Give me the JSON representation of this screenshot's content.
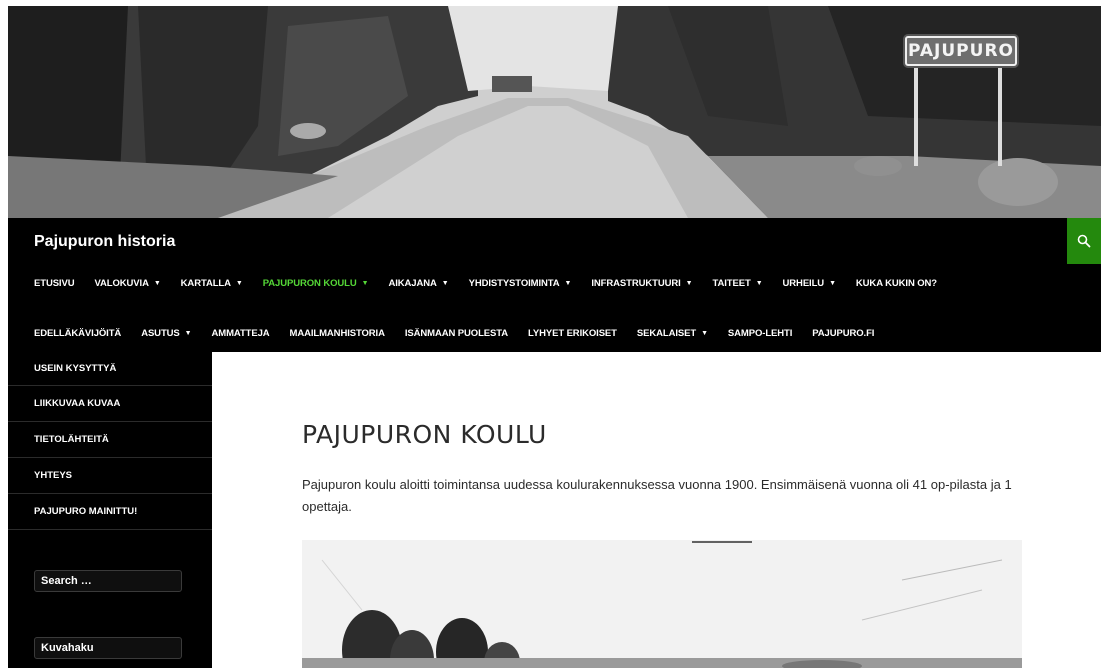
{
  "header": {
    "sign_text": "PAJUPURO"
  },
  "masthead": {
    "site_title": "Pajupuron historia",
    "accent_color": "#24890d",
    "active_color": "#55d737",
    "search_icon": "search-icon"
  },
  "nav": {
    "row1": [
      {
        "label": "ETUSIVU",
        "dropdown": false
      },
      {
        "label": "VALOKUVIA",
        "dropdown": true
      },
      {
        "label": "KARTALLA",
        "dropdown": true
      },
      {
        "label": "PAJUPURON KOULU",
        "dropdown": true,
        "active": true
      },
      {
        "label": "AIKAJANA",
        "dropdown": true
      },
      {
        "label": "YHDISTYSTOIMINTA",
        "dropdown": true
      },
      {
        "label": "INFRASTRUKTUURI",
        "dropdown": true
      },
      {
        "label": "TAITEET",
        "dropdown": true
      },
      {
        "label": "URHEILU",
        "dropdown": true
      },
      {
        "label": "KUKA KUKIN ON?",
        "dropdown": false
      }
    ],
    "row2": [
      {
        "label": "EDELLÄKÄVIJÖITÄ",
        "dropdown": false
      },
      {
        "label": "ASUTUS",
        "dropdown": true
      },
      {
        "label": "AMMATTEJA",
        "dropdown": false
      },
      {
        "label": "MAAILMANHISTORIA",
        "dropdown": false
      },
      {
        "label": "ISÄNMAAN PUOLESTA",
        "dropdown": false
      },
      {
        "label": "LYHYET ERIKOISET",
        "dropdown": false
      },
      {
        "label": "SEKALAISET",
        "dropdown": true
      },
      {
        "label": "SAMPO-LEHTI",
        "dropdown": false
      },
      {
        "label": "PAJUPURO.FI",
        "dropdown": false
      }
    ]
  },
  "sidebar": {
    "links": [
      "USEIN KYSYTTYÄ",
      "LIIKKUVAA KUVAA",
      "TIETOLÄHTEITÄ",
      "YHTEYS",
      "PAJUPURO MAINITTU!"
    ],
    "search_placeholder": "Search …",
    "image_search_value": "Kuvahaku"
  },
  "content": {
    "title": "PAJUPURON KOULU",
    "intro": "Pajupuron koulu aloitti toimintansa uudessa koulurakennuksessa vuonna 1900. Ensimmäisenä vuonna oli 41 op-pilasta ja 1 opettaja."
  }
}
